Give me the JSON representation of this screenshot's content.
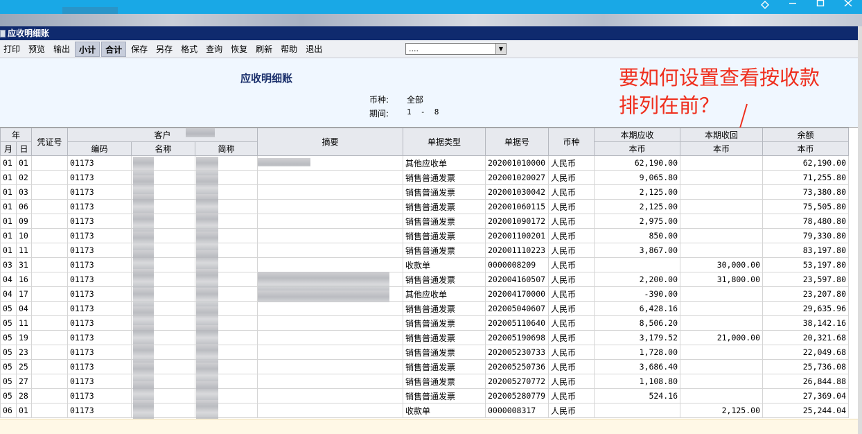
{
  "toolbar": {
    "buttons": [
      "打印",
      "预览",
      "输出",
      "小计",
      "合计",
      "保存",
      "另存",
      "格式",
      "查询",
      "恢复",
      "刷新",
      "帮助",
      "退出"
    ],
    "select_value": "...."
  },
  "window": {
    "title": "应收明细账"
  },
  "report": {
    "title": "应收明细账",
    "currency_label": "币种:",
    "currency_value": "全部",
    "period_label": "期间:",
    "period_value": "1  -  8"
  },
  "annotation": {
    "line1": "要如何设置查看按收款",
    "line2": "排列在前？"
  },
  "table": {
    "headers": {
      "year": "年",
      "month": "月",
      "day": "日",
      "voucher": "凭证号",
      "customer": "客户",
      "code": "编码",
      "name": "名称",
      "short_name": "简称",
      "summary": "摘要",
      "doc_type": "单据类型",
      "doc_no": "单据号",
      "currency": "币种",
      "receivable": "本期应收",
      "received": "本期收回",
      "balance": "余额",
      "local_currency": "本币"
    },
    "rows": [
      [
        "01",
        "01",
        "01173",
        "其他应收单",
        "202001010000",
        "人民币",
        "62,190.00",
        "",
        "62,190.00"
      ],
      [
        "01",
        "02",
        "01173",
        "销售普通发票",
        "202001020027",
        "人民币",
        "9,065.80",
        "",
        "71,255.80"
      ],
      [
        "01",
        "03",
        "01173",
        "销售普通发票",
        "202001030042",
        "人民币",
        "2,125.00",
        "",
        "73,380.80"
      ],
      [
        "01",
        "06",
        "01173",
        "销售普通发票",
        "202001060115",
        "人民币",
        "2,125.00",
        "",
        "75,505.80"
      ],
      [
        "01",
        "09",
        "01173",
        "销售普通发票",
        "202001090172",
        "人民币",
        "2,975.00",
        "",
        "78,480.80"
      ],
      [
        "01",
        "10",
        "01173",
        "销售普通发票",
        "202001100201",
        "人民币",
        "850.00",
        "",
        "79,330.80"
      ],
      [
        "01",
        "11",
        "01173",
        "销售普通发票",
        "202001110223",
        "人民币",
        "3,867.00",
        "",
        "83,197.80"
      ],
      [
        "03",
        "31",
        "01173",
        "收款单",
        "0000008209",
        "人民币",
        "",
        "30,000.00",
        "53,197.80"
      ],
      [
        "04",
        "16",
        "01173",
        "销售普通发票",
        "202004160507",
        "人民币",
        "2,200.00",
        "31,800.00",
        "23,597.80"
      ],
      [
        "04",
        "17",
        "01173",
        "其他应收单",
        "202004170000",
        "人民币",
        "-390.00",
        "",
        "23,207.80"
      ],
      [
        "05",
        "04",
        "01173",
        "销售普通发票",
        "202005040607",
        "人民币",
        "6,428.16",
        "",
        "29,635.96"
      ],
      [
        "05",
        "11",
        "01173",
        "销售普通发票",
        "202005110640",
        "人民币",
        "8,506.20",
        "",
        "38,142.16"
      ],
      [
        "05",
        "19",
        "01173",
        "销售普通发票",
        "202005190698",
        "人民币",
        "3,179.52",
        "21,000.00",
        "20,321.68"
      ],
      [
        "05",
        "23",
        "01173",
        "销售普通发票",
        "202005230733",
        "人民币",
        "1,728.00",
        "",
        "22,049.68"
      ],
      [
        "05",
        "25",
        "01173",
        "销售普通发票",
        "202005250736",
        "人民币",
        "3,686.40",
        "",
        "25,736.08"
      ],
      [
        "05",
        "27",
        "01173",
        "销售普通发票",
        "202005270772",
        "人民币",
        "1,108.80",
        "",
        "26,844.88"
      ],
      [
        "05",
        "28",
        "01173",
        "销售普通发票",
        "202005280779",
        "人民币",
        "524.16",
        "",
        "27,369.04"
      ],
      [
        "06",
        "01",
        "01173",
        "收款单",
        "0000008317",
        "人民币",
        "",
        "2,125.00",
        "25,244.04"
      ]
    ]
  }
}
